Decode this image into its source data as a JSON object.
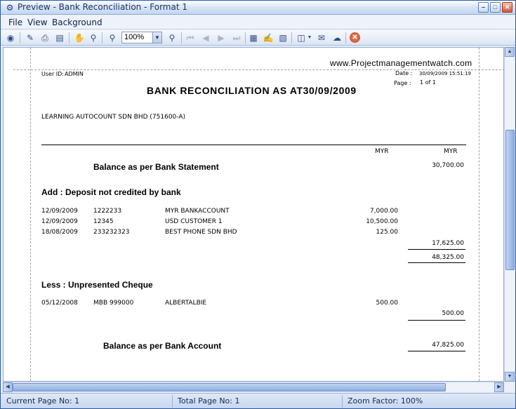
{
  "window": {
    "title": "Preview - Bank Reconciliation - Format 1"
  },
  "menu": {
    "file": "File",
    "view": "View",
    "background": "Background"
  },
  "toolbar": {
    "zoom": "100%"
  },
  "report": {
    "website": "www.Projectmanagementwatch.com",
    "user_id_label": "User ID:",
    "user_id": "ADMIN",
    "date_label": "Date :",
    "date_value": "30/09/2009 15:51:19",
    "page_label": "Page :",
    "page_value": "1 of 1",
    "title": "BANK RECONCILIATION AS AT30/09/2009",
    "company": "LEARNING AUTOCOUNT SDN BHD (751600-A)",
    "col1_currency": "MYR",
    "col2_currency": "MYR",
    "balance_statement_label": "Balance as per Bank Statement",
    "balance_statement_value": "30,700.00",
    "deposit_heading": "Add : Deposit not credited by bank",
    "deposits": [
      {
        "date": "12/09/2009",
        "ref": "1222233",
        "desc": "MYR BANKACCOUNT",
        "amount": "7,000.00"
      },
      {
        "date": "12/09/2009",
        "ref": "12345",
        "desc": "USD CUSTOMER 1",
        "amount": "10,500.00"
      },
      {
        "date": "18/08/2009",
        "ref": "233232323",
        "desc": "BEST PHONE SDN BHD",
        "amount": "125.00"
      }
    ],
    "deposit_total": "17,625.00",
    "subtotal": "48,325.00",
    "cheque_heading": "Less : Unpresented Cheque",
    "cheques": [
      {
        "date": "05/12/2008",
        "ref": "MBB 999000",
        "desc": "ALBERTALBIE",
        "amount": "500.00"
      }
    ],
    "cheque_total": "500.00",
    "balance_account_label": "Balance as per Bank Account",
    "balance_account_value": "47,825.00"
  },
  "status": {
    "current_page": "Current Page No: 1",
    "total_page": "Total Page No: 1",
    "zoom_factor": "Zoom Factor: 100%"
  }
}
